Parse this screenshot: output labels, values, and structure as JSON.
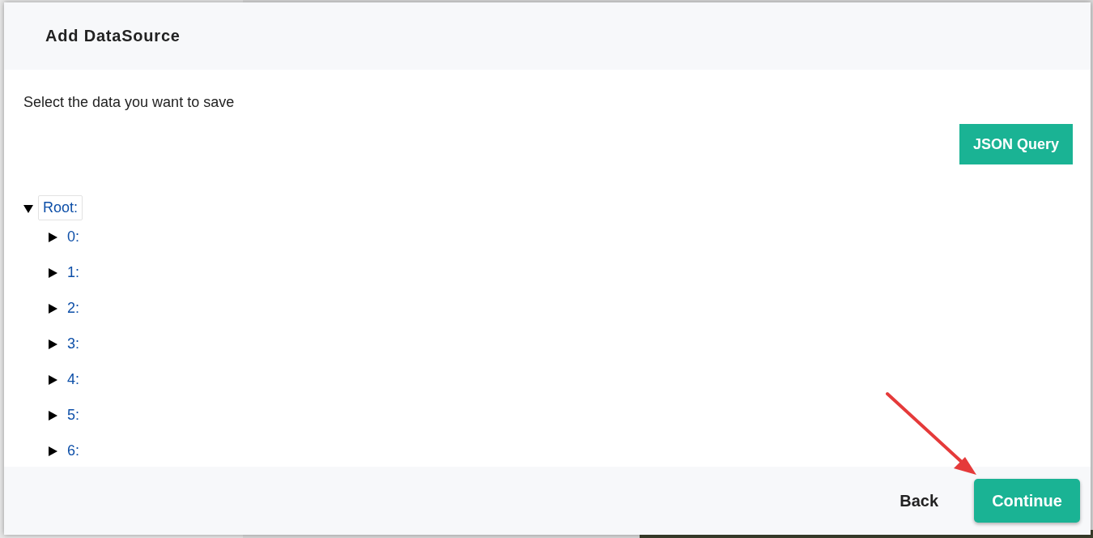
{
  "dialog": {
    "title": "Add DataSource",
    "instruction": "Select the data you want to save",
    "query_button": "JSON Query",
    "tree": {
      "label": "Root:",
      "expanded": true,
      "children": [
        {
          "label": "0:",
          "expanded": false
        },
        {
          "label": "1:",
          "expanded": false
        },
        {
          "label": "2:",
          "expanded": false
        },
        {
          "label": "3:",
          "expanded": false
        },
        {
          "label": "4:",
          "expanded": false
        },
        {
          "label": "5:",
          "expanded": false
        },
        {
          "label": "6:",
          "expanded": false
        }
      ]
    },
    "footer": {
      "back": "Back",
      "continue": "Continue"
    }
  }
}
